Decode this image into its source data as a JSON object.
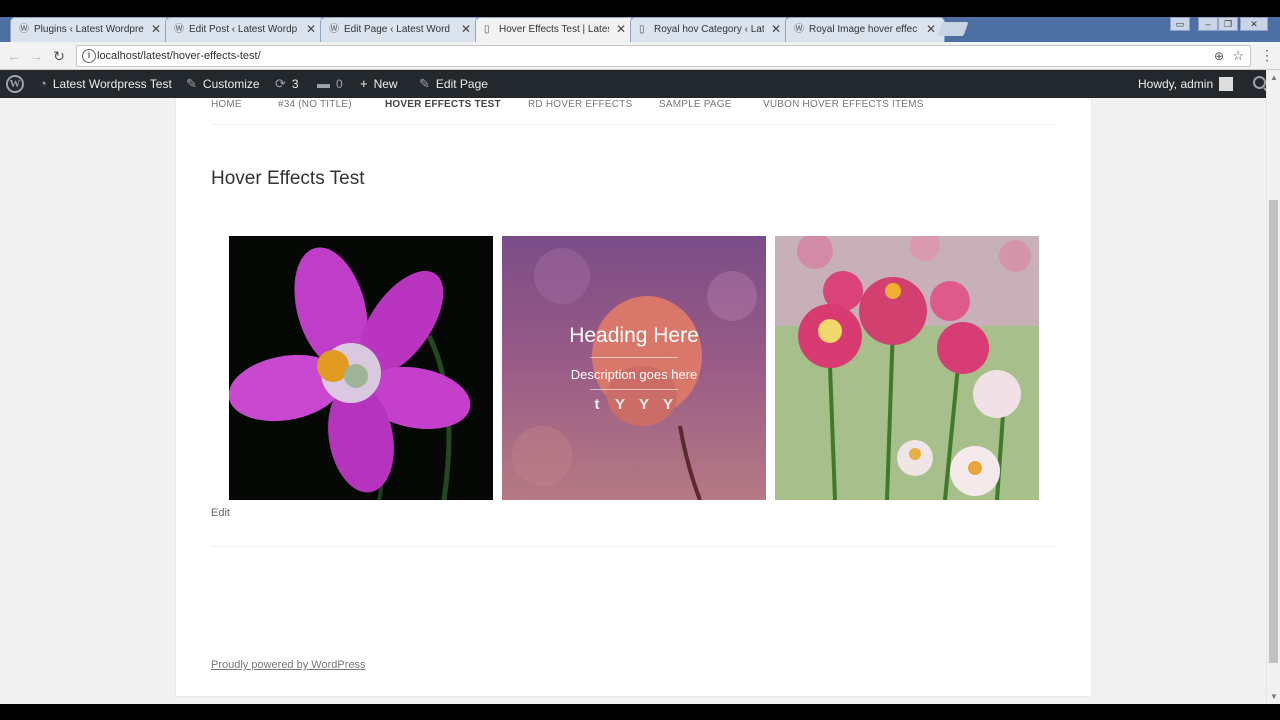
{
  "browser": {
    "tabs": [
      {
        "title": "Plugins ‹ Latest Wordpre",
        "icon": "wordpress-icon",
        "active": false
      },
      {
        "title": "Edit Post ‹ Latest Wordp",
        "icon": "wordpress-icon",
        "active": false
      },
      {
        "title": "Edit Page ‹ Latest Word",
        "icon": "wordpress-icon",
        "active": false
      },
      {
        "title": "Hover Effects Test | Lates",
        "icon": "page-icon",
        "active": true
      },
      {
        "title": "Royal hov Category ‹ Lat",
        "icon": "page-icon",
        "active": false
      },
      {
        "title": "Royal Image hover effec",
        "icon": "wordpress-icon",
        "active": false
      }
    ],
    "close_glyph": "✕",
    "url": "localhost/latest/hover-effects-test/",
    "window_controls": [
      "▭",
      "–",
      "❐",
      "✕"
    ]
  },
  "adminbar": {
    "site_name": "Latest Wordpress Test",
    "customize": "Customize",
    "updates_count": "3",
    "comments_count": "0",
    "new": "New",
    "edit_page": "Edit Page",
    "howdy": "Howdy, admin"
  },
  "site": {
    "nav": [
      "HOME",
      "#34 (NO TITLE)",
      "HOVER EFFECTS TEST",
      "RD HOVER EFFECTS",
      "SAMPLE PAGE",
      "VUBON HOVER EFFECTS ITEMS"
    ],
    "current_nav_index": 2,
    "page_title": "Hover Effects Test",
    "overlay": {
      "heading": "Heading Here",
      "description": "Description goes here",
      "icons": [
        "tumblr-icon",
        "cocktail-icon",
        "cocktail-icon",
        "cocktail-icon"
      ]
    },
    "edit_label": "Edit",
    "footer": "Proudly powered by WordPress"
  },
  "colors": {
    "adminbar_bg": "#23282d",
    "tabbar_bg": "#4d6fa3",
    "page_bg": "#f1f1f1"
  }
}
